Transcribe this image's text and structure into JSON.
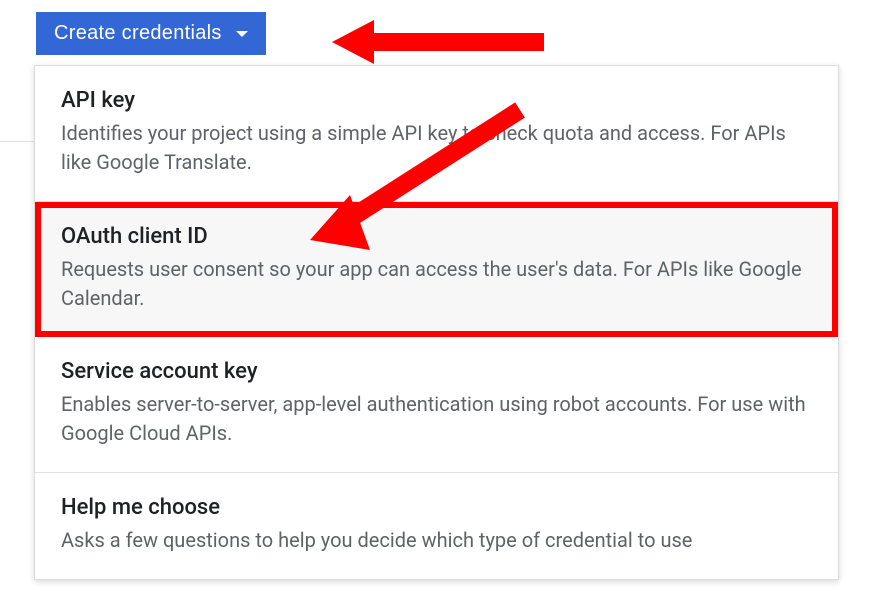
{
  "button": {
    "label": "Create credentials"
  },
  "menu": {
    "items": [
      {
        "title": "API key",
        "desc": "Identifies your project using a simple API key to check quota and access. For APIs like Google Translate."
      },
      {
        "title": "OAuth client ID",
        "desc": "Requests user consent so your app can access the user's data. For APIs like Google Calendar."
      },
      {
        "title": "Service account key",
        "desc": "Enables server-to-server, app-level authentication using robot accounts. For use with Google Cloud APIs."
      },
      {
        "title": "Help me choose",
        "desc": "Asks a few questions to help you decide which type of credential to use"
      }
    ]
  }
}
